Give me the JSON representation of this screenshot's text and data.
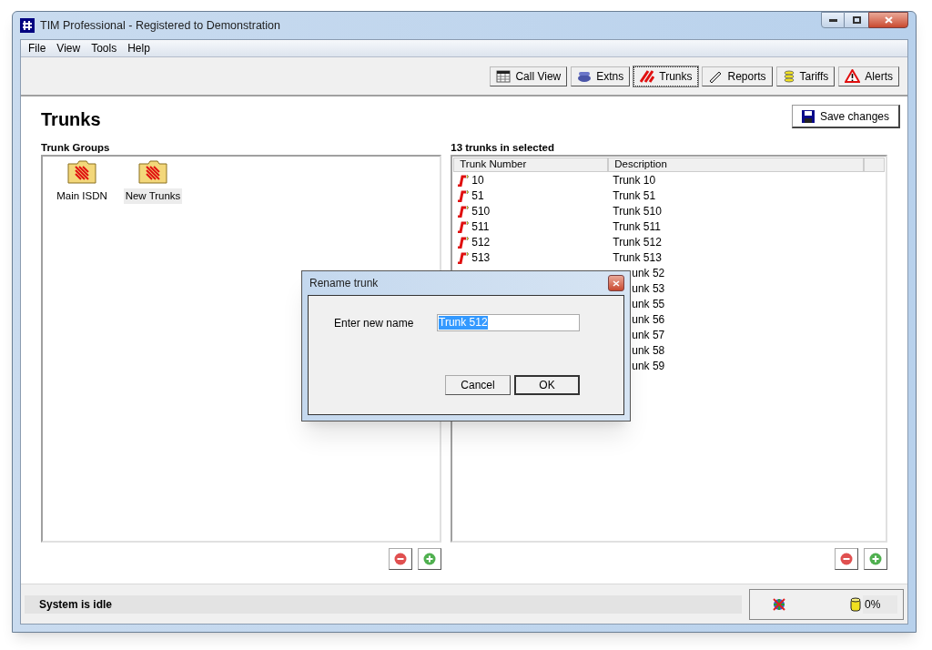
{
  "window": {
    "title": "TIM Professional - Registered to Demonstration"
  },
  "menu": [
    "File",
    "View",
    "Tools",
    "Help"
  ],
  "toolbar": [
    {
      "label": "Call View",
      "selected": false
    },
    {
      "label": "Extns",
      "selected": false
    },
    {
      "label": "Trunks",
      "selected": true
    },
    {
      "label": "Reports",
      "selected": false
    },
    {
      "label": "Tariffs",
      "selected": false
    },
    {
      "label": "Alerts",
      "selected": false
    }
  ],
  "page_title": "Trunks",
  "save_button": "Save changes",
  "groups": {
    "heading": "Trunk Groups",
    "items": [
      {
        "label": "Main ISDN",
        "selected": false
      },
      {
        "label": "New Trunks",
        "selected": true
      }
    ]
  },
  "trunks": {
    "heading": "13 trunks in selected",
    "columns": [
      "Trunk Number",
      "Description"
    ],
    "rows": [
      {
        "number": "10",
        "description": "Trunk 10"
      },
      {
        "number": "51",
        "description": "Trunk 51"
      },
      {
        "number": "510",
        "description": "Trunk 510"
      },
      {
        "number": "511",
        "description": "Trunk 511"
      },
      {
        "number": "512",
        "description": "Trunk 512"
      },
      {
        "number": "513",
        "description": "Trunk 513"
      },
      {
        "description": "unk 52"
      },
      {
        "description": "unk 53"
      },
      {
        "description": "unk 55"
      },
      {
        "description": "unk 56"
      },
      {
        "description": "unk 57"
      },
      {
        "description": "unk 58"
      },
      {
        "description": "unk 59"
      }
    ]
  },
  "dialog": {
    "title": "Rename trunk",
    "label": "Enter new name",
    "value": "Trunk 512",
    "buttons": [
      "Cancel",
      "OK"
    ]
  },
  "status_bar": {
    "message": "System is idle",
    "percent": "0%"
  }
}
